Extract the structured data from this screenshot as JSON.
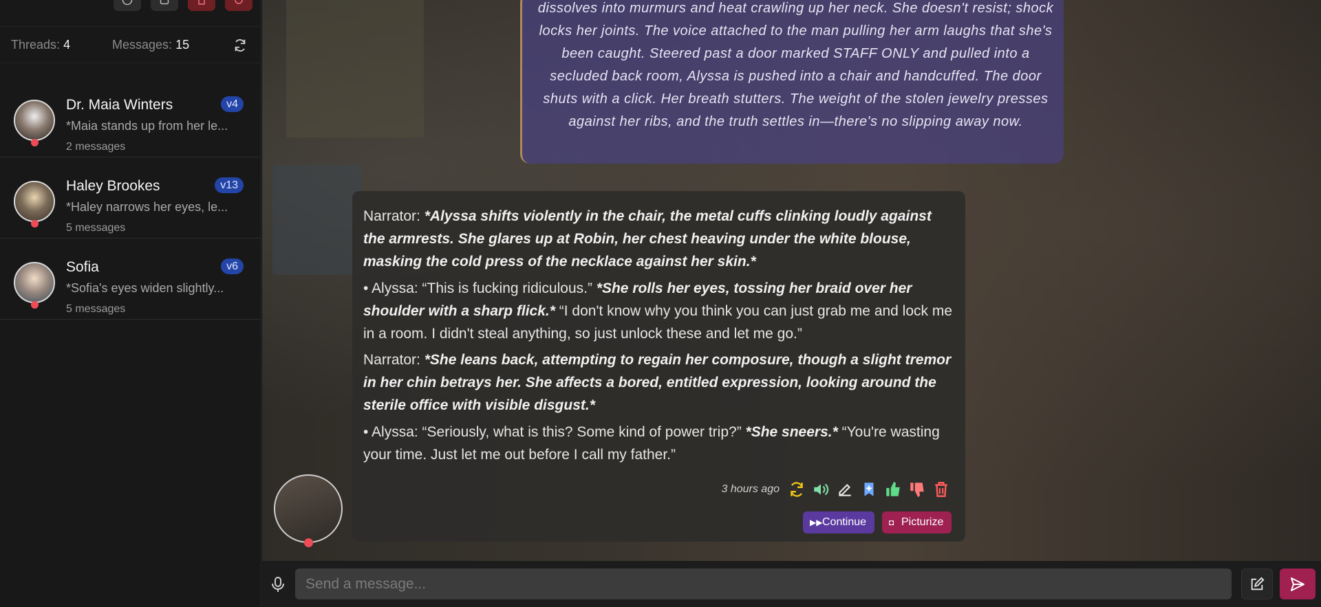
{
  "sidebar": {
    "stats": {
      "threads_label": "Threads:",
      "threads_value": "4",
      "messages_label": "Messages:",
      "messages_value": "15"
    },
    "threads": [
      {
        "name": "Dr. Maia Winters",
        "version": "v4",
        "preview": "*Maia stands up from her le...",
        "count": "2 messages"
      },
      {
        "name": "Haley Brookes",
        "version": "v13",
        "preview": "*Haley narrows her eyes, le...",
        "count": "5 messages"
      },
      {
        "name": "Sofia",
        "version": "v6",
        "preview": "*Sofia's eyes widen slightly...",
        "count": "5 messages"
      }
    ]
  },
  "chat": {
    "narration_box": "dissolves into murmurs and heat crawling up her neck. She doesn't resist; shock locks her joints. The voice attached to the man pulling her arm laughs that she's been caught. Steered past a door marked STAFF ONLY and pulled into a secluded back room, Alyssa is pushed into a chair and handcuffed. The door shuts with a click. Her breath stutters. The weight of the stolen jewelry presses against her ribs, and the truth settles in—there's no slipping away now.",
    "message": {
      "p1_prefix": "Narrator: ",
      "p1_action": "*Alyssa shifts violently in the chair, the metal cuffs clinking loudly against the armrests. She glares up at Robin, her chest heaving under the white blouse, masking the cold press of the necklace against her skin.*",
      "p2_prefix": "• Alyssa: “This is fucking ridiculous.” ",
      "p2_action": "*She rolls her eyes, tossing her braid over her shoulder with a sharp flick.*",
      "p2_suffix": " “I don't know why you think you can just grab me and lock me in a room. I didn't steal anything, so just unlock these and let me go.”",
      "p3_prefix": "Narrator: ",
      "p3_action": "*She leans back, attempting to regain her composure, though a slight tremor in her chin betrays her. She affects a bored, entitled expression, looking around the sterile office with visible disgust.*",
      "p4_prefix": "• Alyssa: “Seriously, what is this? Some kind of power trip?” ",
      "p4_action": "*She sneers.*",
      "p4_suffix": " “You're wasting your time. Just let me out before I call my father.”",
      "timestamp": "3 hours ago",
      "continue_label": "Continue",
      "picturize_label": "Picturize"
    }
  },
  "input": {
    "placeholder": "Send a message..."
  },
  "colors": {
    "accent_blue": "#2445a8",
    "continue_purple": "#5b3aa0",
    "picturize_pink": "#9e2152",
    "send_pink": "#a0204f",
    "status_red": "#ef4b57"
  }
}
